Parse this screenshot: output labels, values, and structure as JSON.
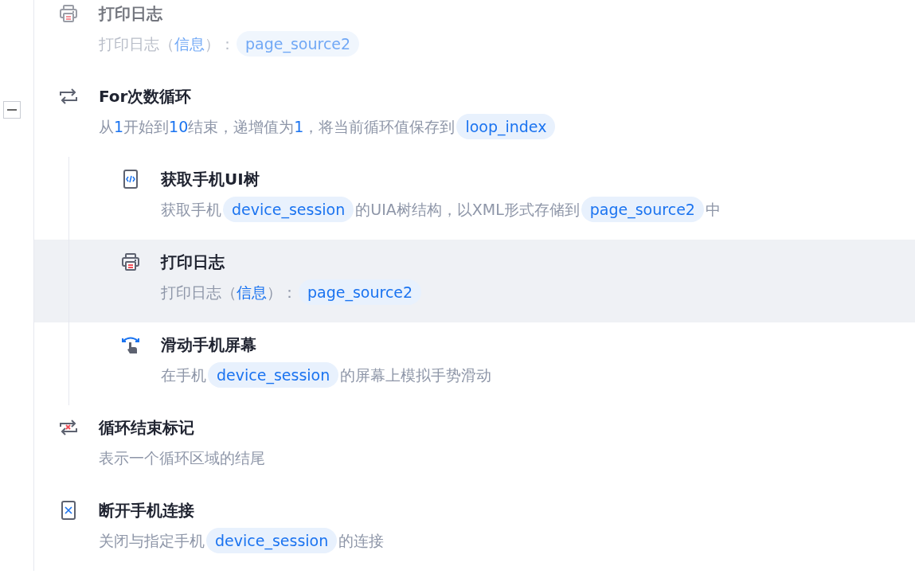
{
  "steps": [
    {
      "kind": "print",
      "title": "打印日志",
      "disabled": true,
      "selected": false,
      "description": [
        {
          "kind": "text",
          "text": "打印日志（"
        },
        {
          "kind": "value",
          "text": "信息"
        },
        {
          "kind": "text",
          "text": "）："
        },
        {
          "kind": "var",
          "text": "page_source2"
        }
      ]
    },
    {
      "kind": "loop",
      "title": "For次数循环",
      "disabled": false,
      "selected": false,
      "expanded": true,
      "description": [
        {
          "kind": "text",
          "text": "从"
        },
        {
          "kind": "value",
          "text": "1"
        },
        {
          "kind": "text",
          "text": "开始到"
        },
        {
          "kind": "value",
          "text": "10"
        },
        {
          "kind": "text",
          "text": "结束，递增值为"
        },
        {
          "kind": "value",
          "text": "1"
        },
        {
          "kind": "text",
          "text": "，将当前循环值保存到"
        },
        {
          "kind": "var",
          "text": "loop_index"
        }
      ],
      "children": [
        {
          "kind": "phone-tree",
          "title": "获取手机UI树",
          "disabled": false,
          "selected": false,
          "description": [
            {
              "kind": "text",
              "text": "获取手机"
            },
            {
              "kind": "var",
              "text": "device_session"
            },
            {
              "kind": "text",
              "text": "的UIA树结构，以XML形式存储到"
            },
            {
              "kind": "var",
              "text": "page_source2"
            },
            {
              "kind": "text",
              "text": "中"
            }
          ]
        },
        {
          "kind": "print",
          "title": "打印日志",
          "disabled": false,
          "selected": true,
          "description": [
            {
              "kind": "text",
              "text": "打印日志（"
            },
            {
              "kind": "value",
              "text": "信息"
            },
            {
              "kind": "text",
              "text": "）："
            },
            {
              "kind": "var",
              "text": "page_source2"
            }
          ]
        },
        {
          "kind": "swipe",
          "title": "滑动手机屏幕",
          "disabled": false,
          "selected": false,
          "description": [
            {
              "kind": "text",
              "text": "在手机"
            },
            {
              "kind": "var",
              "text": "device_session"
            },
            {
              "kind": "text",
              "text": "的屏幕上模拟手势滑动"
            }
          ]
        }
      ]
    },
    {
      "kind": "loop-end",
      "title": "循环结束标记",
      "disabled": false,
      "selected": false,
      "description": [
        {
          "kind": "text",
          "text": "表示一个循环区域的结尾"
        }
      ]
    },
    {
      "kind": "disconnect",
      "title": "断开手机连接",
      "disabled": false,
      "selected": false,
      "description": [
        {
          "kind": "text",
          "text": "关闭与指定手机"
        },
        {
          "kind": "var",
          "text": "device_session"
        },
        {
          "kind": "text",
          "text": "的连接"
        }
      ]
    }
  ]
}
